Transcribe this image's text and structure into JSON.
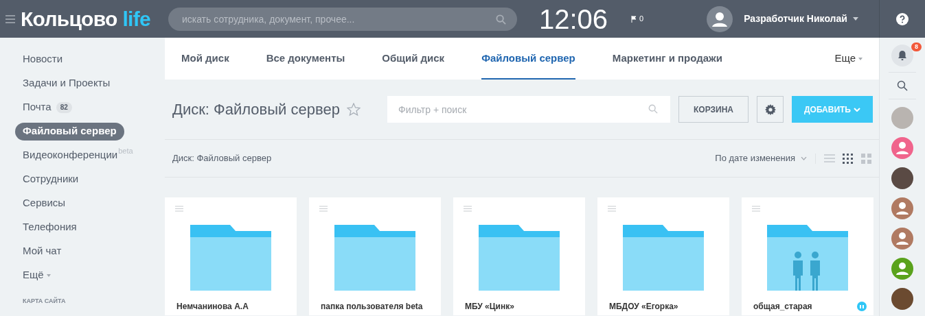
{
  "header": {
    "logo_main": "Кольцово",
    "logo_accent": "life",
    "search": {
      "placeholder": "искать сотрудника, документ, прочее..."
    },
    "clock": "12:06",
    "flag_count": "0",
    "user": "Разработчик Николай"
  },
  "sidebar": {
    "items": [
      {
        "label": "Новости",
        "selected": false
      },
      {
        "label": "Задачи и Проекты",
        "selected": false
      },
      {
        "label": "Почта",
        "selected": false,
        "counter": "82"
      },
      {
        "label": "Файловый сервер",
        "selected": true
      },
      {
        "label": "Видеоконференции",
        "selected": false,
        "superscript": "beta"
      },
      {
        "label": "Сотрудники",
        "selected": false
      },
      {
        "label": "Сервисы",
        "selected": false
      },
      {
        "label": "Телефония",
        "selected": false
      },
      {
        "label": "Мой чат",
        "selected": false
      },
      {
        "label": "Ещё",
        "selected": false,
        "dropdown": true
      }
    ],
    "section_title": "КАРТА САЙТА"
  },
  "tabs": [
    {
      "label": "Мой диск",
      "selected": false
    },
    {
      "label": "Все документы",
      "selected": false
    },
    {
      "label": "Общий диск",
      "selected": false
    },
    {
      "label": "Файловый сервер",
      "selected": true
    },
    {
      "label": "Маркетинг и продажи",
      "selected": false
    }
  ],
  "more_tab": "Еще",
  "page_title": "Диск: Файловый сервер",
  "filter": {
    "placeholder": "Фильтр + поиск"
  },
  "trash_button": "КОРЗИНА",
  "add_button": "ДОБАВИТЬ",
  "breadcrumb": "Диск: Файловый сервер",
  "sort": "По дате изменения",
  "views": [
    {
      "kind": "list",
      "selected": false
    },
    {
      "kind": "small-grid",
      "selected": true
    },
    {
      "kind": "large-grid",
      "selected": false
    }
  ],
  "folders": [
    {
      "name": "Немчанинова А.А",
      "kind": "folder"
    },
    {
      "name": "папка пользователя beta",
      "kind": "folder"
    },
    {
      "name": "МБУ «Цинк»",
      "kind": "folder"
    },
    {
      "name": "МБДОУ «Егорка»",
      "kind": "folder"
    },
    {
      "name": "общая_старая",
      "kind": "shared"
    }
  ],
  "right_rail": {
    "notifications": "8",
    "contacts": [
      {
        "kind": "photo",
        "color": "#b9b4b0"
      },
      {
        "kind": "placeholder",
        "color": "#f0648c"
      },
      {
        "kind": "photo",
        "color": "#5a4a44"
      },
      {
        "kind": "placeholder",
        "color": "#b07a62"
      },
      {
        "kind": "placeholder",
        "color": "#b07a62"
      },
      {
        "kind": "placeholder",
        "color": "#5aa21c"
      },
      {
        "kind": "photo",
        "color": "#6b4a30"
      }
    ]
  }
}
